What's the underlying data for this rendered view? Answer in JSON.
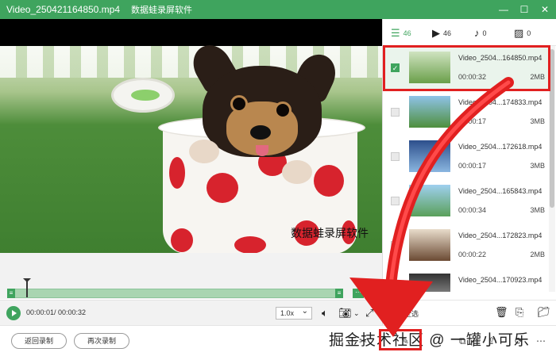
{
  "titlebar": {
    "file_name": "Video_250421164850.mp4",
    "app_name": "数据蛙录屏软件"
  },
  "player": {
    "watermark": "数据蛙录屏软件",
    "current_time": "00:00:01/ 00:00:32",
    "speed": "1.0x"
  },
  "tabs": [
    {
      "icon": "list-icon",
      "count": "46"
    },
    {
      "icon": "video-icon",
      "count": "46"
    },
    {
      "icon": "music-icon",
      "count": "0"
    },
    {
      "icon": "image-icon",
      "count": "0"
    }
  ],
  "videos": [
    {
      "name": "Video_2504...164850.mp4",
      "duration": "00:00:32",
      "size": "2MB",
      "selected": true
    },
    {
      "name": "Video_2504...174833.mp4",
      "duration": "00:00:17",
      "size": "3MB",
      "selected": false
    },
    {
      "name": "Video_2504...172618.mp4",
      "duration": "00:00:17",
      "size": "3MB",
      "selected": false
    },
    {
      "name": "Video_2504...165843.mp4",
      "duration": "00:00:34",
      "size": "3MB",
      "selected": false
    },
    {
      "name": "Video_2504...172823.mp4",
      "duration": "00:00:22",
      "size": "2MB",
      "selected": false
    },
    {
      "name": "Video_2504...170923.mp4",
      "duration": "",
      "size": "",
      "selected": false
    }
  ],
  "panel_footer": {
    "select_all": "全选"
  },
  "bottombar": {
    "back_button": "返回录制",
    "again_button": "再次录制",
    "watermark": "掘金技术社区 @ 一罐小可乐"
  },
  "colors": {
    "brand_green": "#3fa45e",
    "highlight_red": "#e12020"
  }
}
